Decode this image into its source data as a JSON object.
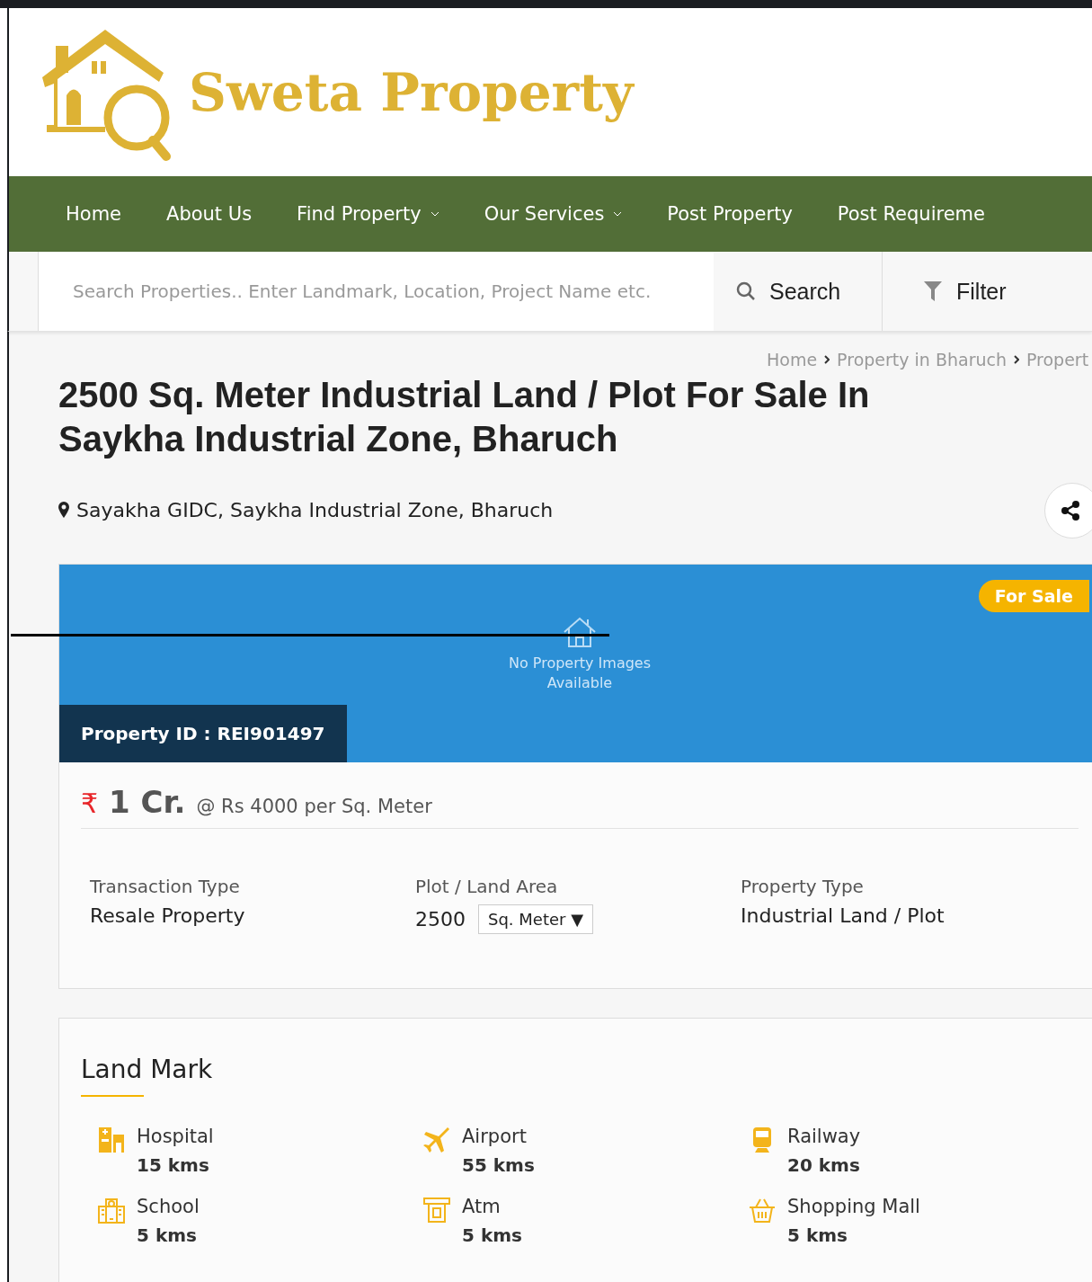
{
  "brand": {
    "name": "Sweta Property"
  },
  "nav": [
    {
      "label": "Home",
      "has_dropdown": false
    },
    {
      "label": "About Us",
      "has_dropdown": false
    },
    {
      "label": "Find Property",
      "has_dropdown": true
    },
    {
      "label": "Our Services",
      "has_dropdown": true
    },
    {
      "label": "Post Property",
      "has_dropdown": false
    },
    {
      "label": "Post Requireme",
      "has_dropdown": false
    }
  ],
  "search": {
    "placeholder": "Search Properties.. Enter Landmark, Location, Project Name etc.",
    "button": "Search",
    "filter": "Filter"
  },
  "breadcrumb": [
    "Home",
    "Property in Bharuch",
    "Propert"
  ],
  "title": "2500 Sq. Meter Industrial Land / Plot For Sale In Saykha Industrial Zone, Bharuch",
  "location": "Sayakha GIDC, Saykha Industrial Zone, Bharuch",
  "image_area": {
    "message": "No Property Images Available",
    "badge": "For Sale",
    "property_id": "Property ID : REI901497"
  },
  "price": {
    "currency": "₹",
    "amount": "1 Cr.",
    "rate": "@ Rs 4000 per Sq. Meter"
  },
  "details": [
    {
      "label": "Transaction Type",
      "value": "Resale Property"
    },
    {
      "label": "Plot / Land Area",
      "value": "2500",
      "unit": "Sq. Meter ▼"
    },
    {
      "label": "Property Type",
      "value": "Industrial Land / Plot"
    }
  ],
  "landmarks": {
    "title": "Land Mark",
    "items": [
      {
        "kind": "hospital",
        "name": "Hospital",
        "distance": "15 kms"
      },
      {
        "kind": "airport",
        "name": "Airport",
        "distance": "55 kms"
      },
      {
        "kind": "railway",
        "name": "Railway",
        "distance": "20 kms"
      },
      {
        "kind": "school",
        "name": "School",
        "distance": "5 kms"
      },
      {
        "kind": "atm",
        "name": "Atm",
        "distance": "5 kms"
      },
      {
        "kind": "mall",
        "name": "Shopping Mall",
        "distance": "5 kms"
      }
    ]
  }
}
